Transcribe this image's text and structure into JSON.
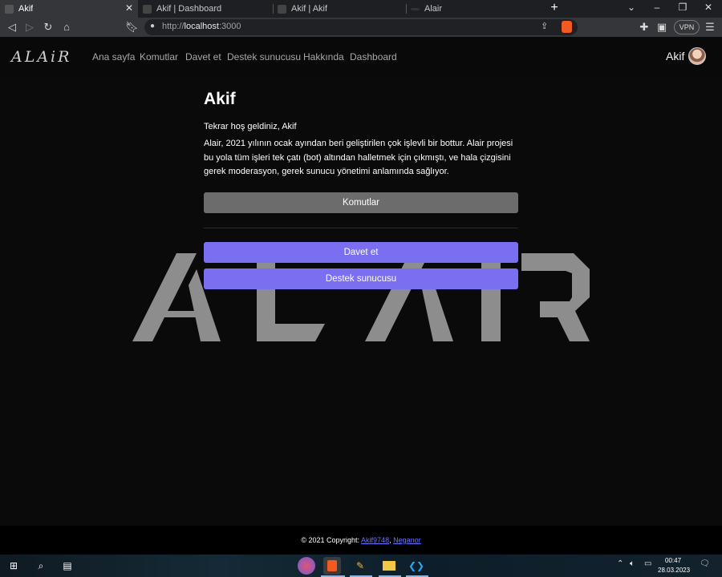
{
  "browser": {
    "tabs": [
      {
        "title": "Akif",
        "active": true
      },
      {
        "title": "Akif | Dashboard",
        "active": false
      },
      {
        "title": "Akif | Akif",
        "active": false
      },
      {
        "title": "Alair",
        "active": false
      }
    ],
    "new_tab": "+",
    "url_prefix": "http://",
    "url_host": "localhost",
    "url_port": ":3000",
    "vpn_label": "VPN"
  },
  "navbar": {
    "logo": "ALAiR",
    "links": [
      "Ana sayfa",
      "Komutlar",
      "Davet et",
      "Destek sunucusu",
      "Hakkında",
      "Dashboard"
    ],
    "user_name": "Akif"
  },
  "main": {
    "heading": "Akif",
    "welcome": "Tekrar hoş geldiniz, Akif",
    "description": "Alair, 2021 yılının ocak ayından beri geliştirilen çok işlevli bir bottur. Alair projesi bu yola tüm işleri tek çatı (bot) altından halletmek için çıkmıştı, ve hala çizgisini gerek moderasyon, gerek sunucu yönetimi anlamında sağlıyor.",
    "buttons": {
      "commands": "Komutlar",
      "invite": "Davet et",
      "support": "Destek sunucusu"
    }
  },
  "footer": {
    "copyright": "© 2021 Copyright: ",
    "author1": "Akif9748",
    "separator": ", ",
    "author2": "Neganor"
  },
  "taskbar": {
    "time": "00:47",
    "date": "28.03.2023"
  },
  "colors": {
    "accent": "#7a6ff0",
    "secondary_button": "#6c6c6c",
    "page_bg": "#0a0a0a",
    "link": "#6b72ff"
  }
}
